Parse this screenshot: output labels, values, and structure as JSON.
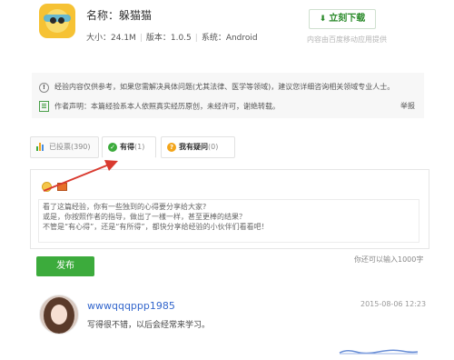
{
  "app": {
    "name": "名称：躲猫猫",
    "size": "大小：24.1M",
    "version": "版本：1.0.5",
    "system": "系统：Android",
    "download_label": "立刻下载",
    "download_icon": "download-icon",
    "download_note": "内容由百度移动应用提供"
  },
  "notice": {
    "disclaimer": "经验内容仅供参考，如果您需解决具体问题(尤其法律、医学等领域)，建议您详细咨询相关领域专业人士。",
    "author_statement": "作者声明：本篇经验系本人依照真实经历原创，未经许可，谢绝转载。",
    "report_label": "举报"
  },
  "tabs": [
    {
      "label": "已投票",
      "count": "(390)",
      "icon": "bar-chart-icon"
    },
    {
      "label": "有得",
      "count": "(1)",
      "icon": "check-icon"
    },
    {
      "label": "我有疑问",
      "count": "(0)",
      "icon": "question-icon"
    }
  ],
  "composer": {
    "lines": [
      "看了这篇经验，你有一些独到的心得要分享给大家?",
      "或是，你按照作者的指导，做出了一樣一样，甚至更棒的结果？",
      "不管是“有心得”，还是“有所得”，都快分享给经验的小伙伴们看看吧！"
    ],
    "char_count": "你还可以输入1000字",
    "publish_label": "发布"
  },
  "comment": {
    "username": "wwwqqqppp1985",
    "time": "2015-08-06 12:23",
    "text": "写得很不错，以后会经常来学习。"
  },
  "colors": {
    "accent_green": "#3cab3c",
    "link_blue": "#3366cc",
    "arrow_red": "#d93a2f"
  }
}
